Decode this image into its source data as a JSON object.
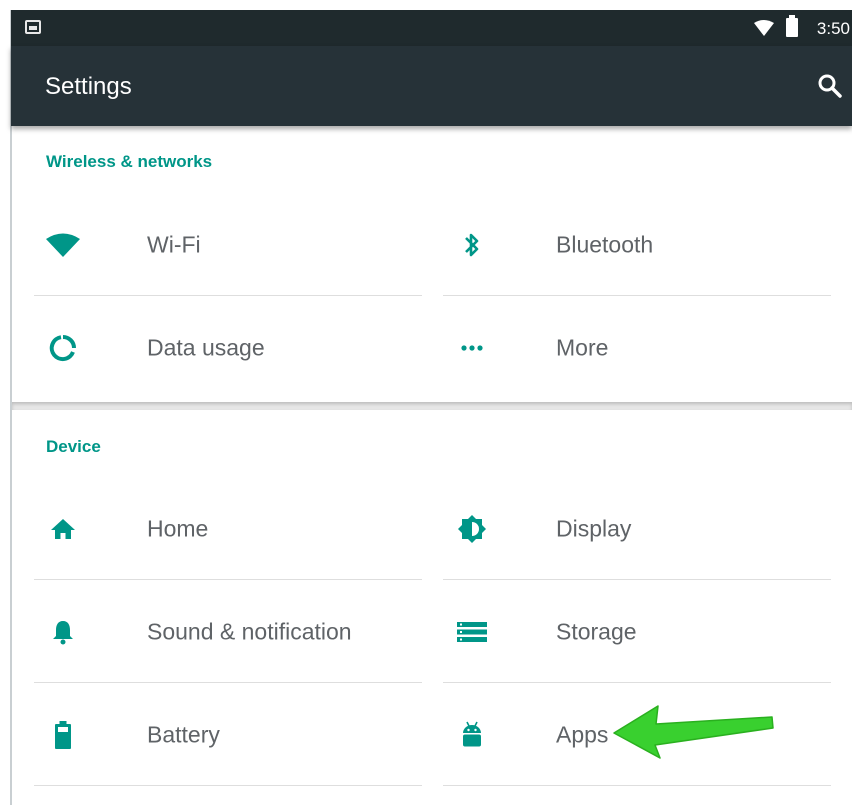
{
  "status_bar": {
    "time": "3:50",
    "icons": [
      "picture-notification-icon",
      "wifi-signal-icon",
      "battery-icon"
    ]
  },
  "app_bar": {
    "title": "Settings",
    "search_icon": "search-icon"
  },
  "sections": [
    {
      "header": "Wireless & networks",
      "items": [
        {
          "label": "Wi-Fi",
          "icon": "wifi-icon"
        },
        {
          "label": "Bluetooth",
          "icon": "bluetooth-icon"
        },
        {
          "label": "Data usage",
          "icon": "data-usage-icon"
        },
        {
          "label": "More",
          "icon": "more-icon"
        }
      ]
    },
    {
      "header": "Device",
      "items": [
        {
          "label": "Home",
          "icon": "home-icon"
        },
        {
          "label": "Display",
          "icon": "display-brightness-icon"
        },
        {
          "label": "Sound & notification",
          "icon": "bell-icon"
        },
        {
          "label": "Storage",
          "icon": "storage-icon"
        },
        {
          "label": "Battery",
          "icon": "battery-icon"
        },
        {
          "label": "Apps",
          "icon": "android-icon"
        }
      ]
    }
  ],
  "annotation": {
    "arrow_color": "#33cc33",
    "points_to": "Apps"
  },
  "colors": {
    "accent": "#009688",
    "app_bar": "#263238",
    "status_bar": "#1f2a2d",
    "label_text": "#5f6367"
  }
}
